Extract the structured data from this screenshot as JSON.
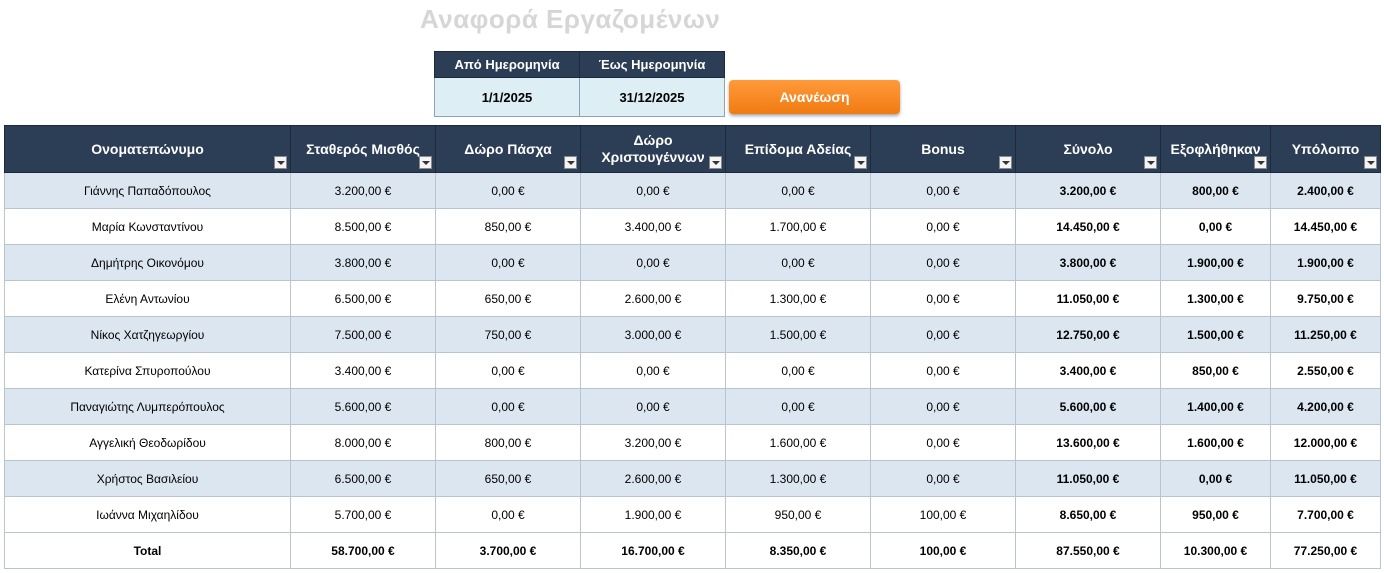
{
  "title": "Αναφορά Εργαζομένων",
  "date_filter": {
    "from_label": "Από Ημερομηνία",
    "to_label": "Έως Ημερομηνία",
    "from_value": "1/1/2025",
    "to_value": "31/12/2025"
  },
  "refresh_label": "Ανανέωση",
  "columns": [
    "Ονοματεπώνυμο",
    "Σταθερός Μισθός",
    "Δώρο Πάσχα",
    "Δώρο Χριστουγέννων",
    "Επίδομα Αδείας",
    "Bonus",
    "Σύνολο",
    "Εξοφλήθηκαν",
    "Υπόλοιπο"
  ],
  "rows": [
    [
      "Γιάννης Παπαδόπουλος",
      "3.200,00 €",
      "0,00 €",
      "0,00 €",
      "0,00 €",
      "0,00 €",
      "3.200,00 €",
      "800,00 €",
      "2.400,00 €"
    ],
    [
      "Μαρία Κωνσταντίνου",
      "8.500,00 €",
      "850,00 €",
      "3.400,00 €",
      "1.700,00 €",
      "0,00 €",
      "14.450,00 €",
      "0,00 €",
      "14.450,00 €"
    ],
    [
      "Δημήτρης Οικονόμου",
      "3.800,00 €",
      "0,00 €",
      "0,00 €",
      "0,00 €",
      "0,00 €",
      "3.800,00 €",
      "1.900,00 €",
      "1.900,00 €"
    ],
    [
      "Ελένη Αντωνίου",
      "6.500,00 €",
      "650,00 €",
      "2.600,00 €",
      "1.300,00 €",
      "0,00 €",
      "11.050,00 €",
      "1.300,00 €",
      "9.750,00 €"
    ],
    [
      "Νίκος Χατζηγεωργίου",
      "7.500,00 €",
      "750,00 €",
      "3.000,00 €",
      "1.500,00 €",
      "0,00 €",
      "12.750,00 €",
      "1.500,00 €",
      "11.250,00 €"
    ],
    [
      "Κατερίνα Σπυροπούλου",
      "3.400,00 €",
      "0,00 €",
      "0,00 €",
      "0,00 €",
      "0,00 €",
      "3.400,00 €",
      "850,00 €",
      "2.550,00 €"
    ],
    [
      "Παναγιώτης Λυμπερόπουλος",
      "5.600,00 €",
      "0,00 €",
      "0,00 €",
      "0,00 €",
      "0,00 €",
      "5.600,00 €",
      "1.400,00 €",
      "4.200,00 €"
    ],
    [
      "Αγγελική Θεοδωρίδου",
      "8.000,00 €",
      "800,00 €",
      "3.200,00 €",
      "1.600,00 €",
      "0,00 €",
      "13.600,00 €",
      "1.600,00 €",
      "12.000,00 €"
    ],
    [
      "Χρήστος Βασιλείου",
      "6.500,00 €",
      "650,00 €",
      "2.600,00 €",
      "1.300,00 €",
      "0,00 €",
      "11.050,00 €",
      "0,00 €",
      "11.050,00 €"
    ],
    [
      "Ιωάννα Μιχαηλίδου",
      "5.700,00 €",
      "0,00 €",
      "1.900,00 €",
      "950,00 €",
      "100,00 €",
      "8.650,00 €",
      "950,00 €",
      "7.700,00 €"
    ]
  ],
  "total": [
    "Total",
    "58.700,00 €",
    "3.700,00 €",
    "16.700,00 €",
    "8.350,00 €",
    "100,00 €",
    "87.550,00 €",
    "10.300,00 €",
    "77.250,00 €"
  ],
  "colors": {
    "header_bg": "#2c3e55",
    "alt_row_bg": "#dce6f0",
    "date_value_bg": "#ddeef4",
    "button_accent": "#f5881f"
  },
  "icons": {
    "filter": "filter-dropdown-icon"
  }
}
